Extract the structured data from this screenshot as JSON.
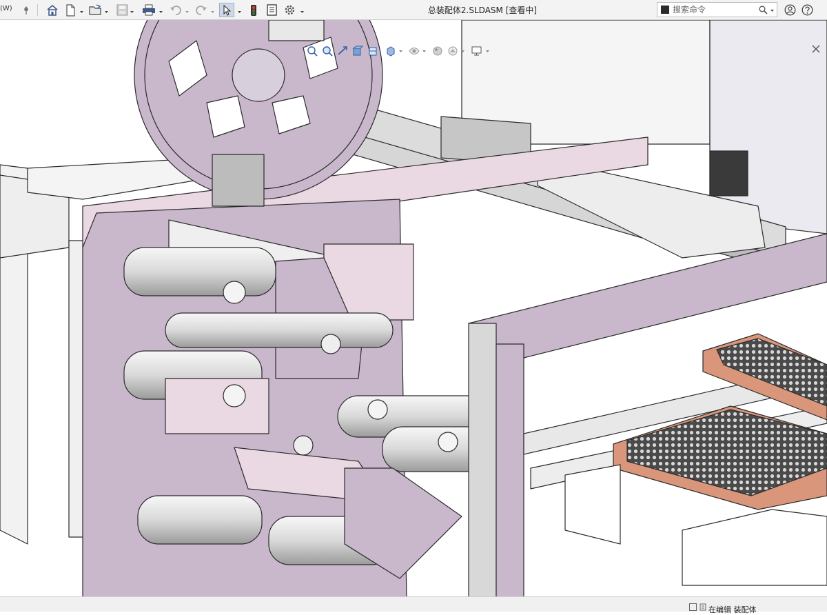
{
  "app": {
    "title": "总装配体2.SLDASM [查看中]",
    "menu_stub": "(W)"
  },
  "toolbar": {
    "items": [
      {
        "name": "pin-icon"
      },
      {
        "name": "home-icon"
      },
      {
        "name": "new-document-icon"
      },
      {
        "name": "open-folder-icon"
      },
      {
        "name": "save-icon"
      },
      {
        "name": "print-icon"
      },
      {
        "name": "undo-icon"
      },
      {
        "name": "redo-icon"
      },
      {
        "name": "select-pointer-icon"
      },
      {
        "name": "rebuild-traffic-light-icon"
      },
      {
        "name": "file-properties-icon"
      },
      {
        "name": "options-gear-icon"
      }
    ]
  },
  "search": {
    "placeholder": "搜索命令"
  },
  "status": {
    "text": "在编辑 装配体"
  },
  "colors": {
    "part_lilac": "#c9b7cc",
    "part_pink": "#ead8e2",
    "part_grey": "#d2d2d2",
    "tray_copper": "#d9967a",
    "line": "#2a2a2a"
  }
}
